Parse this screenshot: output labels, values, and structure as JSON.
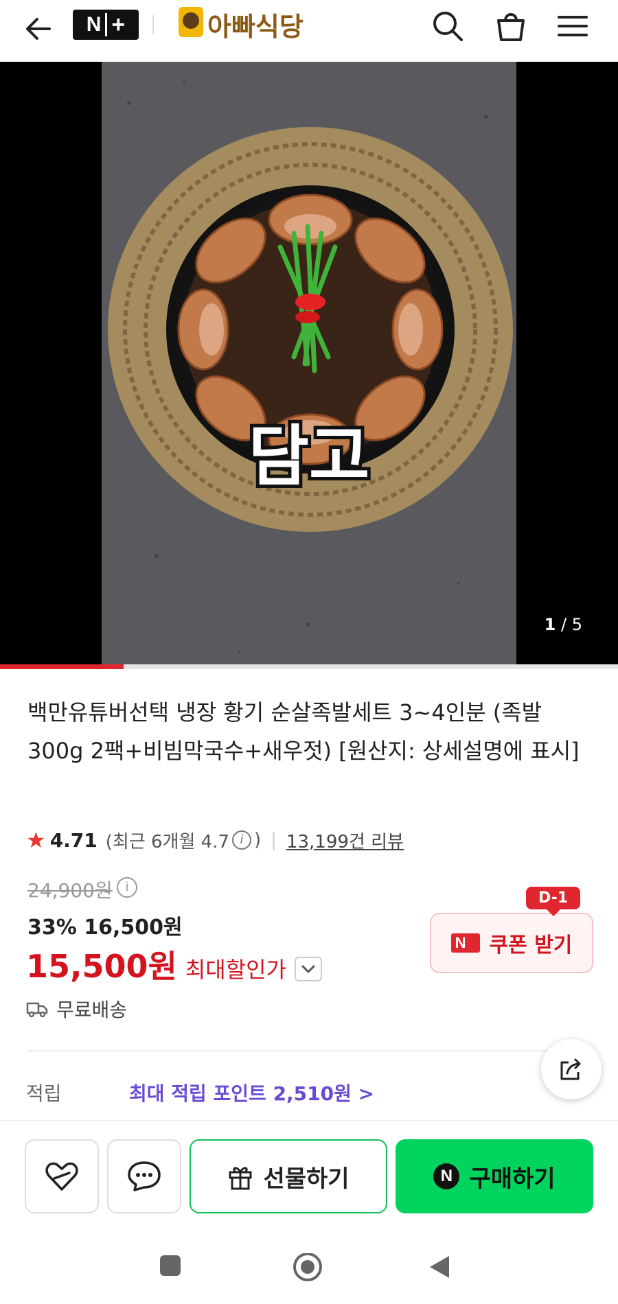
{
  "header": {
    "nplus_n": "N",
    "nplus_plus": "+",
    "store_name": "아빠식당"
  },
  "media": {
    "overlay_text": "담고",
    "counter_current": "1",
    "counter_total": "/ 5",
    "progress": 0.2
  },
  "product": {
    "title": "백만유튜버선택 냉장 황기 순살족발세트 3~4인분 (족발300g 2팩+비빔막국수+새우젓) [원산지: 상세설명에 표시]",
    "rating": "4.71",
    "rating_recent": "(최근 6개월 4.7",
    "rating_close": ")",
    "review_count": "13,199건 리뷰",
    "original_price": "24,900원",
    "discount": "33% 16,500원",
    "final_price": "15,500원",
    "final_label": "최대할인가",
    "shipping": "무료배송",
    "points_label": "적립",
    "points_value": "최대 적립 포인트 2,510원 >"
  },
  "coupon": {
    "label": "쿠폰 받기",
    "dday": "D-1"
  },
  "bottom": {
    "gift_label": "선물하기",
    "buy_label": "구매하기"
  },
  "colors": {
    "accent_red": "#d3141f",
    "buy_green": "#00d45f",
    "points_purple": "#6a4ad4",
    "store_brown": "#8a5a14"
  }
}
